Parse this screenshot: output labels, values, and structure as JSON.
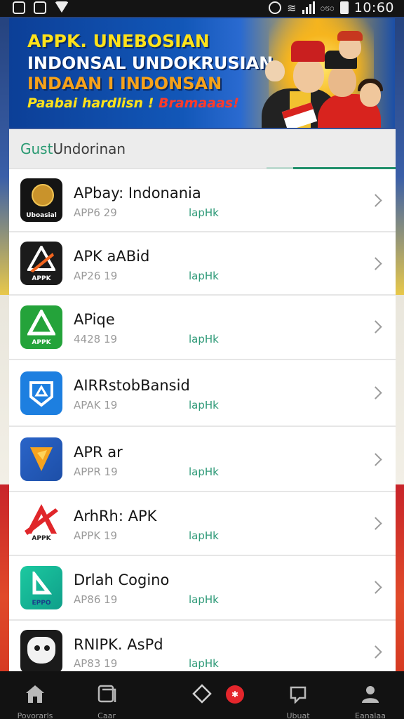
{
  "status_bar": {
    "carrier_text": "೦೮೦",
    "time": "10:60"
  },
  "banner": {
    "line1": "APPK. UNEBOSIAN",
    "line2": "INDONSAL UNDOKRUSIAN",
    "line3": "INDAAN I INDONSAN",
    "line4_prefix": "Paabai hardlisn ! ",
    "line4_accent": "Bramaaas!"
  },
  "panel": {
    "header_accent": "Gust",
    "header_text": " Undorinan",
    "colors": {
      "accent": "#1f8f6a",
      "tag": "#2f9a78"
    }
  },
  "apps": [
    {
      "name": "APbay: Indonania",
      "meta": "APP6 29",
      "tag": "lapHk",
      "icon": "emblem-icon",
      "icon_text": "Uboasial"
    },
    {
      "name": "APK aABid",
      "meta": "AP26 19",
      "tag": "lapHk",
      "icon": "apk-triangle-icon",
      "icon_text": "APPK"
    },
    {
      "name": "APiqe",
      "meta": "4428 19",
      "tag": "lapHk",
      "icon": "apk-green-icon",
      "icon_text": "APPK"
    },
    {
      "name": "AIRRstobBansid",
      "meta": "APAK 19",
      "tag": "lapHk",
      "icon": "shield-store-icon",
      "icon_text": ""
    },
    {
      "name": "APR ar",
      "meta": "APPR 19",
      "tag": "lapHk",
      "icon": "orange-tile-icon",
      "icon_text": ""
    },
    {
      "name": "ArhRh: APK",
      "meta": "APPK 19",
      "tag": "lapHk",
      "icon": "red-a-icon",
      "icon_text": "APPK"
    },
    {
      "name": "Drlah Cogino",
      "meta": "AP86 19",
      "tag": "lapHk",
      "icon": "teal-d-icon",
      "icon_text": "EPPO"
    },
    {
      "name": "RNIPK. AsPd",
      "meta": "AP83 19",
      "tag": "lapHk",
      "icon": "mascot-icon",
      "icon_text": ""
    }
  ],
  "bottom_nav": {
    "items": [
      {
        "label": "Povorarls",
        "icon": "home-icon"
      },
      {
        "label": "Caar",
        "icon": "card-icon"
      },
      {
        "label": "",
        "icon": "hexagon-icon"
      },
      {
        "label": "Ubuat",
        "icon": "chat-icon"
      },
      {
        "label": "Eanalaa",
        "icon": "profile-icon"
      }
    ],
    "badge_text": "✱"
  }
}
